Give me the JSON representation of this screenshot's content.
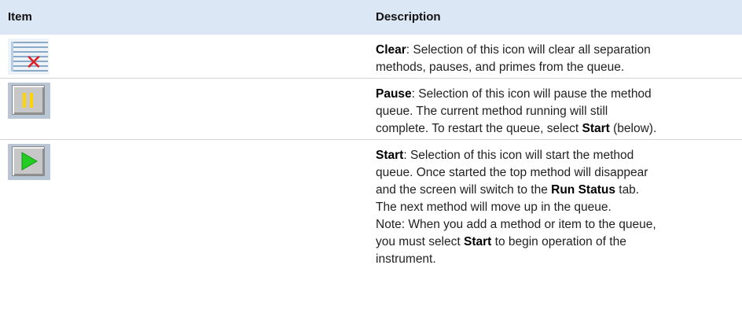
{
  "header": {
    "item": "Item",
    "description": "Description"
  },
  "rows": [
    {
      "icon": "clear-queue-icon",
      "term": "Clear",
      "lines": [
        ": Selection of this icon will clear all separation",
        "methods, pauses, and primes from the queue."
      ]
    },
    {
      "icon": "pause-icon",
      "term": "Pause",
      "lines": [
        ": Selection of this icon will pause the method",
        "queue. The current method running will still",
        "complete. To restart the queue, select ",
        "Start",
        " (below)."
      ]
    },
    {
      "icon": "play-icon",
      "term": "Start",
      "lines": [
        ": Selection of this icon will start the method",
        "queue. Once started the top method will disappear",
        "and the screen will switch to the ",
        "Run Status",
        " tab.",
        "The next method will move up in the queue.",
        "Note: When you add a method or item to the queue,",
        "you must select ",
        "Start",
        " to begin operation of the",
        "instrument."
      ]
    }
  ],
  "colors": {
    "header_bg": "#dbe7f5",
    "play_green": "#22cc22",
    "pause_yellow": "#ffd400",
    "clear_red": "#e02020"
  }
}
